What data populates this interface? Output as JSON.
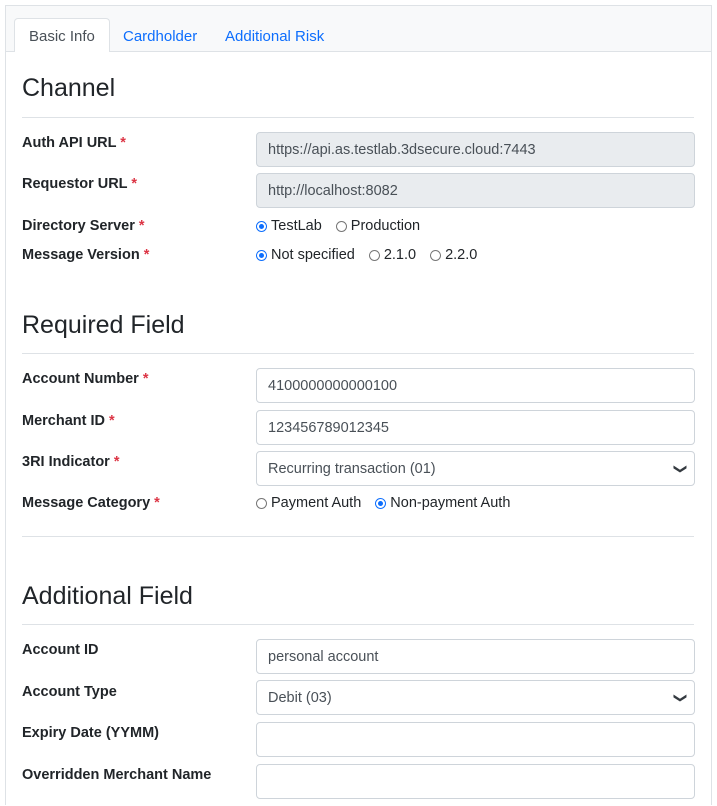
{
  "tabs": [
    "Basic Info",
    "Cardholder",
    "Additional Risk"
  ],
  "required_marker": "*",
  "channel": {
    "title": "Channel",
    "auth_api_url": {
      "label": "Auth API URL",
      "value": "https://api.as.testlab.3dsecure.cloud:7443"
    },
    "requestor_url": {
      "label": "Requestor URL",
      "value": "http://localhost:8082"
    },
    "directory_server": {
      "label": "Directory Server",
      "options": [
        "TestLab",
        "Production"
      ],
      "selected": "TestLab"
    },
    "message_version": {
      "label": "Message Version",
      "options": [
        "Not specified",
        "2.1.0",
        "2.2.0"
      ],
      "selected": "Not specified"
    }
  },
  "required_field": {
    "title": "Required Field",
    "account_number": {
      "label": "Account Number",
      "value": "4100000000000100"
    },
    "merchant_id": {
      "label": "Merchant ID",
      "value": "123456789012345"
    },
    "three_ri_indicator": {
      "label": "3RI Indicator",
      "value": "Recurring transaction (01)"
    },
    "message_category": {
      "label": "Message Category",
      "options": [
        "Payment Auth",
        "Non-payment Auth"
      ],
      "selected": "Non-payment Auth"
    }
  },
  "additional_field": {
    "title": "Additional Field",
    "account_id": {
      "label": "Account ID",
      "value": "personal account"
    },
    "account_type": {
      "label": "Account Type",
      "value": "Debit (03)"
    },
    "expiry_date": {
      "label": "Expiry Date (YYMM)",
      "value": ""
    },
    "overridden_merchant_name": {
      "label": "Overridden Merchant Name",
      "value": ""
    }
  },
  "icons": {
    "select_chevron": "chevron-down-icon",
    "radio": "radio-button-icon"
  },
  "colors": {
    "accent": "#0d6efd",
    "required": "#dc3545",
    "readonly_bg": "#e9ecef",
    "border": "#dee2e6"
  }
}
